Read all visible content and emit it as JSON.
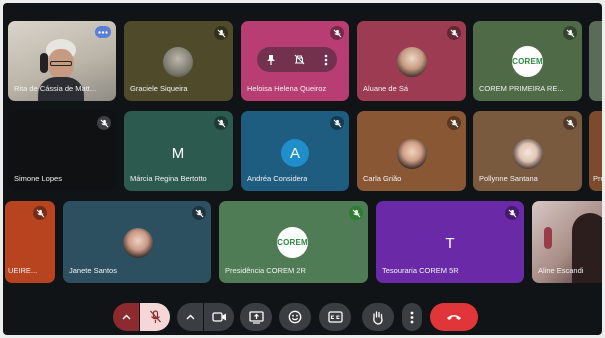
{
  "participants": [
    {
      "name": "Rita de Cássia de Matt...",
      "avatar": "webcam-photo"
    },
    {
      "name": "Graciele Siqueira",
      "avatar": "profile-photo"
    },
    {
      "name": "Heloisa Helena Queiroz",
      "avatar": "none"
    },
    {
      "name": "Aluane de Sá",
      "avatar": "profile-photo"
    },
    {
      "name": "COREM PRIMEIRA RE...",
      "avatar": "corem-logo"
    },
    {
      "name": "Simone Lopes",
      "avatar": "none"
    },
    {
      "name": "Márcia Regina Bertotto",
      "avatar": "letter",
      "letter": "M"
    },
    {
      "name": "Andréa Considera",
      "avatar": "letter",
      "letter": "A"
    },
    {
      "name": "Carla Grião",
      "avatar": "profile-photo"
    },
    {
      "name": "Pollynne Santana",
      "avatar": "profile-photo"
    },
    {
      "name": "Pre",
      "avatar": "none"
    },
    {
      "name": "UEIRE...",
      "avatar": "none"
    },
    {
      "name": "Janete Santos",
      "avatar": "profile-photo"
    },
    {
      "name": "Presidência COREM 2R",
      "avatar": "corem-logo"
    },
    {
      "name": "Tesouraria COREM 5R",
      "avatar": "letter",
      "letter": "T"
    },
    {
      "name": "Aline Escandi",
      "avatar": "webcam-photo"
    }
  ],
  "logo_text": "COREM",
  "colors": {
    "background": "#111417",
    "end_call": "#e0363a",
    "mic_muted_bg": "#f6d7d7",
    "control_bg": "#3a3e42"
  },
  "controls": [
    "mic-options-chevron",
    "mic-off",
    "camera-options-chevron",
    "camera",
    "present-screen",
    "emoji",
    "captions",
    "raise-hand",
    "more-options",
    "end-call"
  ],
  "tile_overlay": [
    "pin",
    "mute",
    "more-vert"
  ]
}
